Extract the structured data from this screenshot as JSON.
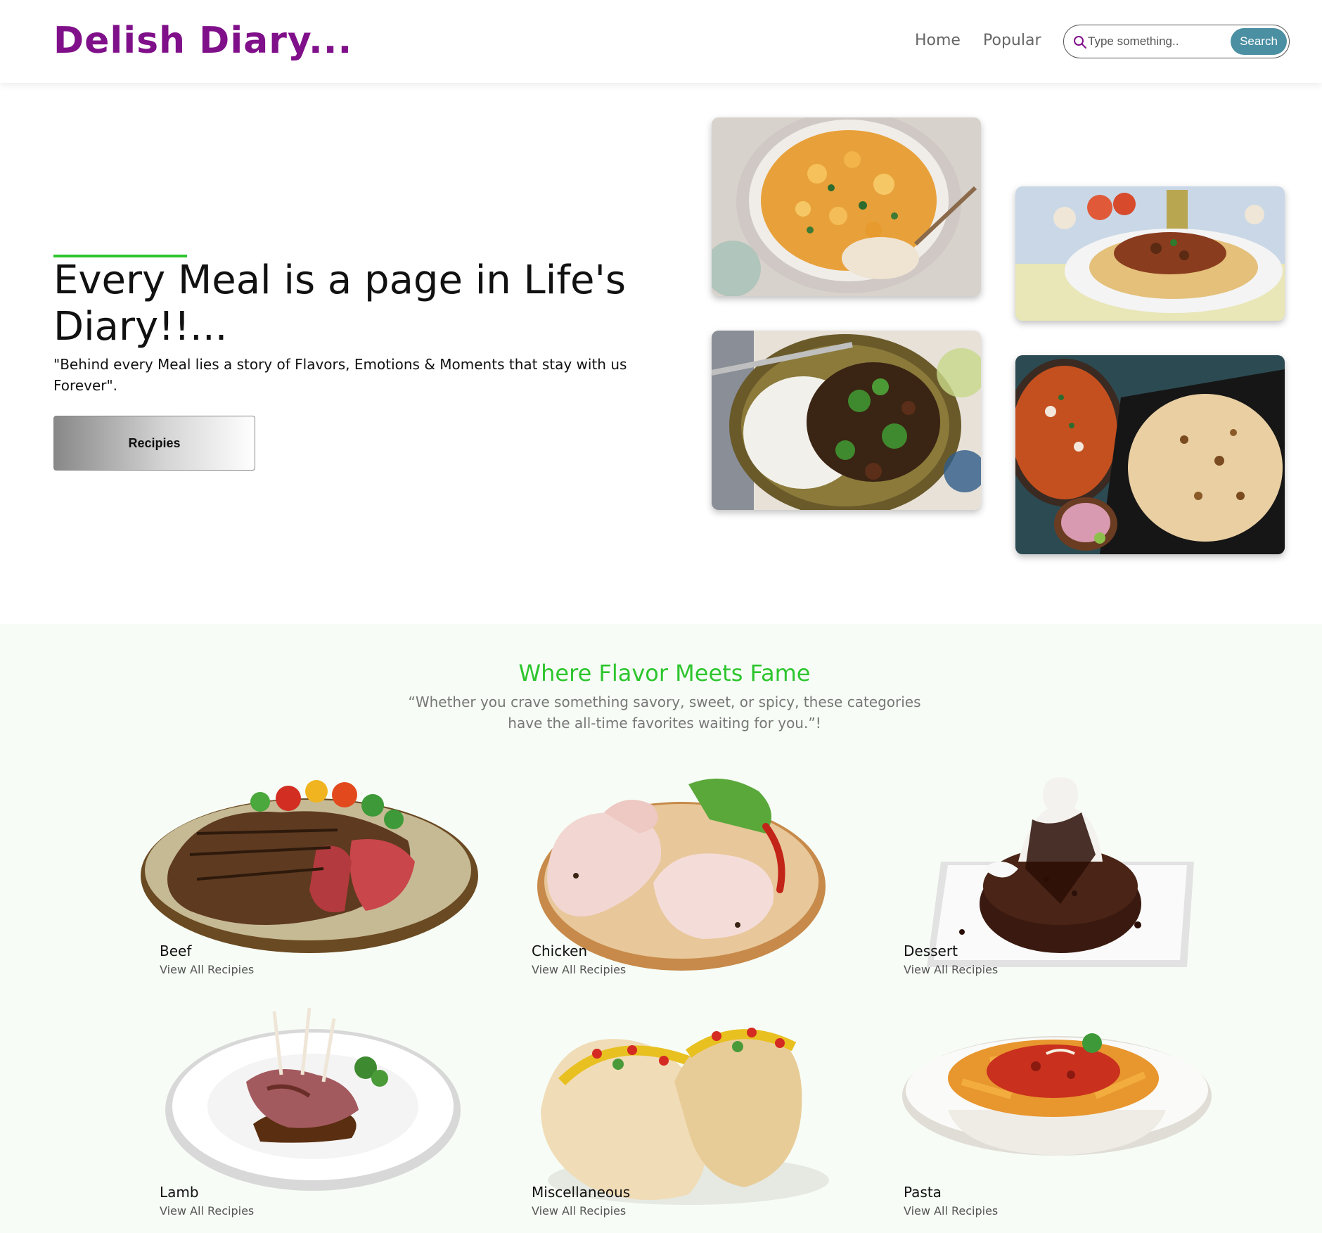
{
  "brand": "Delish Diary...",
  "nav": {
    "home": "Home",
    "popular": "Popular"
  },
  "search": {
    "placeholder": "Type something..",
    "button": "Search"
  },
  "hero": {
    "title": "Every Meal is a page in Life's Diary!!...",
    "quote": "\"Behind every Meal lies a story of Flavors, Emotions & Moments that stay with us Forever\".",
    "button": "Recipies"
  },
  "categories": {
    "title": "Where Flavor Meets Fame",
    "subtitle": "“Whether you crave something savory, sweet, or spicy, these categories have the all-time favorites waiting for you.”!",
    "items": [
      {
        "name": "Beef",
        "link": "View All Recipies"
      },
      {
        "name": "Chicken",
        "link": "View All Recipies"
      },
      {
        "name": "Dessert",
        "link": "View All Recipies"
      },
      {
        "name": "Lamb",
        "link": "View All Recipies"
      },
      {
        "name": "Miscellaneous",
        "link": "View All Recipies"
      },
      {
        "name": "Pasta",
        "link": "View All Recipies"
      }
    ]
  },
  "colors": {
    "brand": "#80108a",
    "accent_green": "#2ec52e",
    "search_button": "#4b8fa3",
    "section_bg": "#f7fdf6"
  },
  "icons": [
    "search-icon"
  ]
}
